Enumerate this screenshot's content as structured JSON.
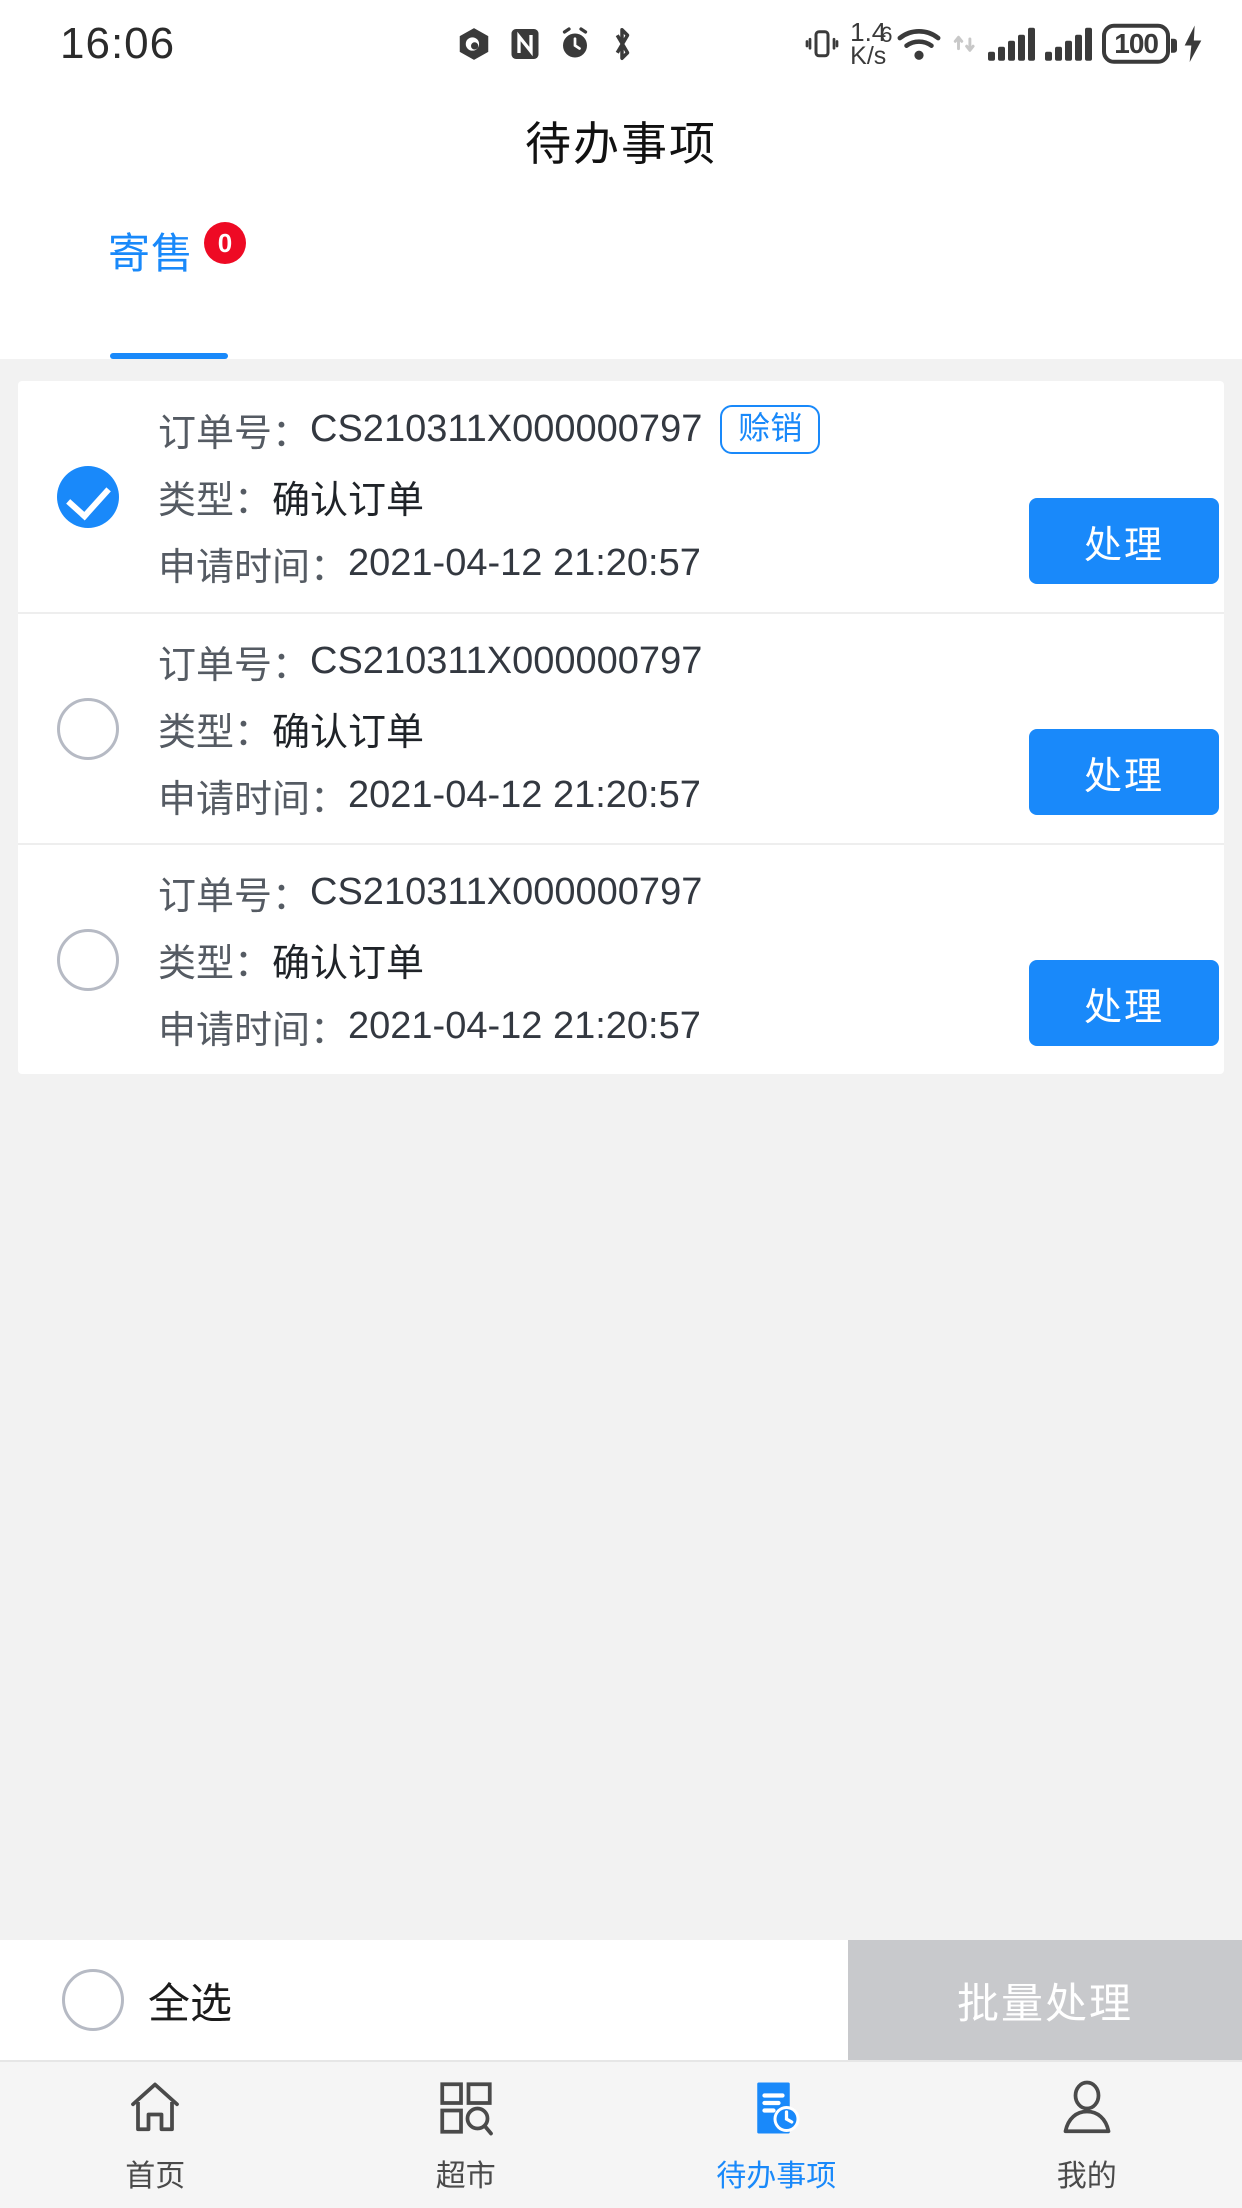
{
  "statusbar": {
    "time": "16:06",
    "netspeed_value": "1.4",
    "netspeed_unit": "K/s",
    "wifi_gen": "6",
    "wifi_plus": "+",
    "battery_level": "100",
    "icons": [
      "eye-care-icon",
      "nfc-icon",
      "alarm-icon",
      "bluetooth-icon",
      "vibrate-icon",
      "wifi-icon",
      "data-transfer-icon",
      "signal-icon",
      "signal-icon-2",
      "battery-icon",
      "charging-bolt-icon"
    ]
  },
  "header": {
    "title": "待办事项"
  },
  "tabs": [
    {
      "label": "寄售",
      "badge": "0",
      "active": true
    }
  ],
  "list": {
    "labels": {
      "order_no": "订单号：",
      "type": "类型：",
      "apply_time": "申请时间："
    },
    "rows": [
      {
        "order_no": "CS210311X000000797",
        "type": "确认订单",
        "apply_time": "2021-04-12  21:20:57",
        "pill": "赊销",
        "has_pill": true,
        "checked": true,
        "action_label": "处理"
      },
      {
        "order_no": "CS210311X000000797",
        "type": "确认订单",
        "apply_time": "2021-04-12  21:20:57",
        "pill": "",
        "has_pill": false,
        "checked": false,
        "action_label": "处理"
      },
      {
        "order_no": "CS210311X000000797",
        "type": "确认订单",
        "apply_time": "2021-04-12  21:20:57",
        "pill": "",
        "has_pill": false,
        "checked": false,
        "action_label": "处理"
      }
    ]
  },
  "actionbar": {
    "select_all_label": "全选",
    "select_all_checked": false,
    "batch_label": "批量处理",
    "batch_disabled": true
  },
  "navbar": {
    "items": [
      {
        "label": "首页",
        "icon": "home-icon",
        "active": false
      },
      {
        "label": "超市",
        "icon": "grid-search-icon",
        "active": false
      },
      {
        "label": "待办事项",
        "icon": "todo-clock-icon",
        "active": true
      },
      {
        "label": "我的",
        "icon": "person-icon",
        "active": false
      }
    ]
  },
  "colors": {
    "accent": "#1989fa",
    "badge_red": "#ee0a24",
    "disabled_gray": "#c8c9cc",
    "page_bg": "#f2f2f2"
  }
}
